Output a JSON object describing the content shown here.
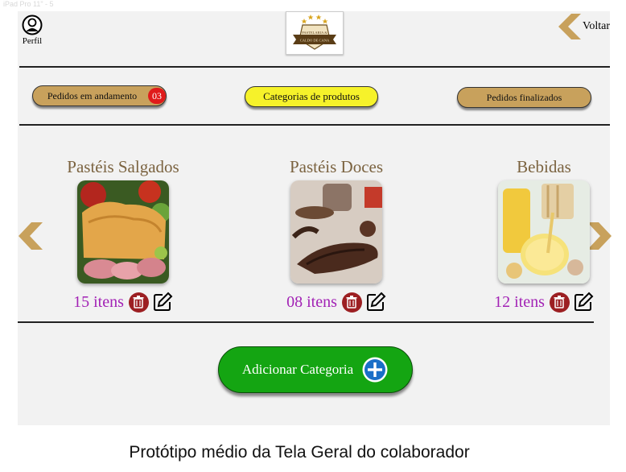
{
  "frame_label": "iPad Pro 11\" - 5",
  "header": {
    "profile_label": "Perfil",
    "logo_text": "PASTELARIA & CALDO DE CANA",
    "back_label": "Voltar"
  },
  "tabs": {
    "in_progress_label": "Pedidos em andamento",
    "in_progress_count": "03",
    "categories_label": "Categorias de produtos",
    "finished_label": "Pedidos finalizados"
  },
  "categories": [
    {
      "title": "Pastéis Salgados",
      "count": "15 itens",
      "image": "savory-pastry-photo"
    },
    {
      "title": "Pastéis Doces",
      "count": "08 itens",
      "image": "chocolate-pastry-photo"
    },
    {
      "title": "Bebidas",
      "count": "12 itens",
      "image": "juice-drinks-photo"
    }
  ],
  "add_button_label": "Adicionar Categoria",
  "caption": "Protótipo médio da Tela Geral do colaborador",
  "colors": {
    "gold": "#c8a15c",
    "yellow": "#f6f22a",
    "green": "#14a512",
    "count_purple": "#a222b5",
    "title_brown": "#7b6340",
    "trash_red": "#9c1f22"
  }
}
